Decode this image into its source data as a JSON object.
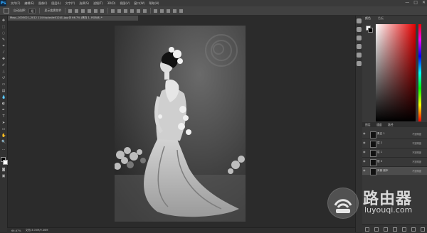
{
  "app": {
    "logo": "Ps",
    "menu": [
      "文件(F)",
      "编辑(E)",
      "图像(I)",
      "图层(L)",
      "文字(Y)",
      "选择(S)",
      "滤镜(T)",
      "3D(D)",
      "视图(V)",
      "窗口(W)",
      "帮助(H)"
    ],
    "window_controls": [
      "—",
      "□",
      "✕"
    ]
  },
  "options_bar": {
    "tool_icon": "move-tool-icon",
    "auto_select_label": "自动选择:",
    "auto_select_value": "组",
    "transform_label": "显示变换控件"
  },
  "document": {
    "tab_title": "Mosc_1005021_2012 114 ticpicsiie012(0).jpg @ 66.7% (黑白 1, RGB/8) *",
    "zoom": "66.67%",
    "status": "文档:3.05M/9.46M"
  },
  "panels": {
    "color_tabs": [
      "颜色",
      "色板"
    ],
    "layers_tabs": [
      "图层",
      "通道",
      "路径"
    ],
    "layers": [
      {
        "name": "黑白 1",
        "opacity": "不透明度",
        "selected": false
      },
      {
        "name": "层 2",
        "opacity": "不透明度",
        "selected": false
      },
      {
        "name": "层 1",
        "opacity": "不透明度",
        "selected": false
      },
      {
        "name": "层 0",
        "opacity": "不透明度",
        "selected": false
      },
      {
        "name": "背景 副本",
        "opacity": "不透明度",
        "selected": true
      }
    ]
  },
  "watermark": {
    "title": "路由器",
    "url": "luyouqi.com"
  },
  "colors": {
    "menubar": "#3a3a3a",
    "workspace": "#2b2b2b",
    "panel": "#383838",
    "brand": "#31a8ff"
  }
}
